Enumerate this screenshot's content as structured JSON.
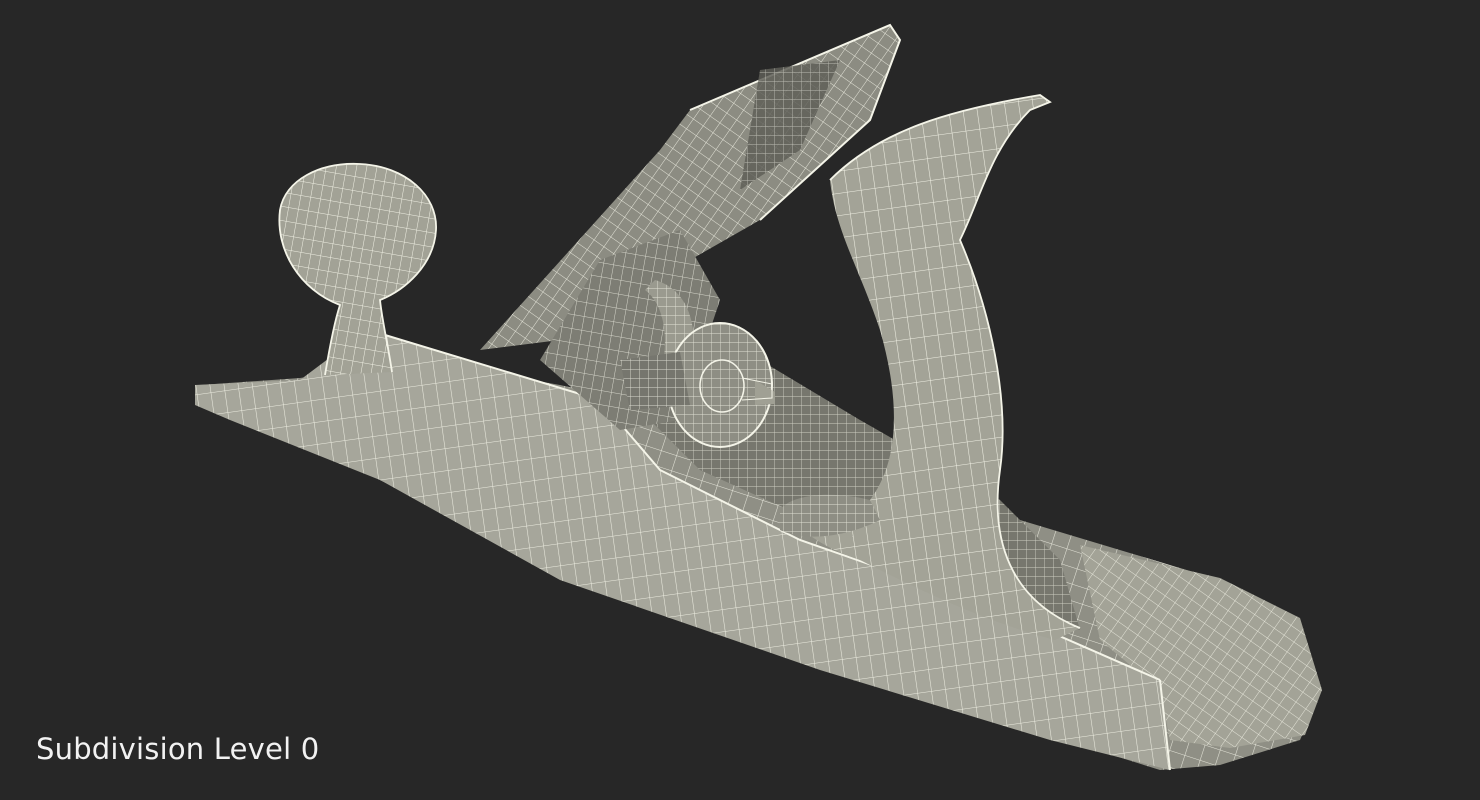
{
  "caption": "Subdivision Level 0",
  "colors": {
    "background": "#272727",
    "surface": "#9a9a8f",
    "surface_shade": "#6f6f66",
    "wire": "#f4f4e8"
  }
}
